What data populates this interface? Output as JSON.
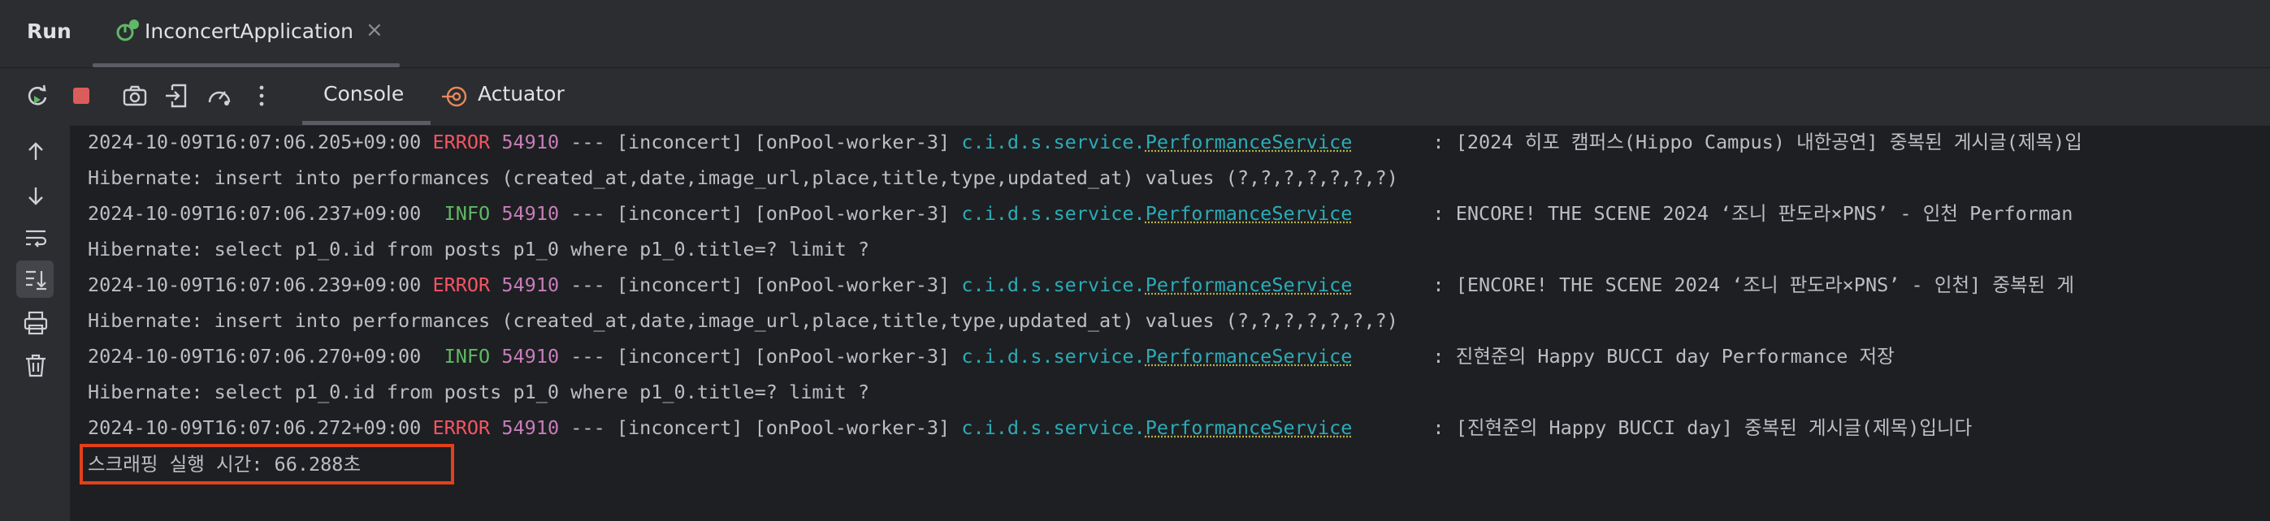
{
  "header": {
    "run_label": "Run",
    "app_tab_label": "InconcertApplication",
    "close_glyph": "×"
  },
  "toolbar": {
    "icons": [
      "rerun-icon",
      "stop-icon",
      "camera-icon",
      "exit-icon",
      "dashboard-icon",
      "more-icon"
    ],
    "console_tab": "Console",
    "actuator_tab": "Actuator"
  },
  "gutter": {
    "icons": [
      "arrow-up-icon",
      "arrow-down-icon",
      "soft-wrap-icon",
      "scroll-to-end-icon",
      "print-icon",
      "trash-icon"
    ]
  },
  "colors": {
    "error": "#f75464",
    "info": "#5fb865",
    "pid": "#c77dba",
    "logger": "#2aacb8",
    "highlight": "#e2401c"
  },
  "console": {
    "lines": [
      {
        "type": "log",
        "timestamp": "2024-10-09T16:07:06.205+09:00",
        "level": "ERROR",
        "pid": "54910",
        "sep": " --- ",
        "app": "[inconcert] [onPool-worker-3] ",
        "logger_pkg": "c.i.d.s.service.",
        "logger_cls": "PerformanceService",
        "msg": "       : [2024 히포 캠퍼스(Hippo Campus) 내한공연] 중복된 게시글(제목)입"
      },
      {
        "type": "text",
        "text": "Hibernate: insert into performances (created_at,date,image_url,place,title,type,updated_at) values (?,?,?,?,?,?,?)"
      },
      {
        "type": "log",
        "timestamp": "2024-10-09T16:07:06.237+09:00",
        "level": " INFO",
        "pid": "54910",
        "sep": " --- ",
        "app": "[inconcert] [onPool-worker-3] ",
        "logger_pkg": "c.i.d.s.service.",
        "logger_cls": "PerformanceService",
        "msg": "       : ENCORE! THE SCENE 2024 ‘조니 판도라×PNS’ - 인천 Performan"
      },
      {
        "type": "text",
        "text": "Hibernate: select p1_0.id from posts p1_0 where p1_0.title=? limit ?"
      },
      {
        "type": "log",
        "timestamp": "2024-10-09T16:07:06.239+09:00",
        "level": "ERROR",
        "pid": "54910",
        "sep": " --- ",
        "app": "[inconcert] [onPool-worker-3] ",
        "logger_pkg": "c.i.d.s.service.",
        "logger_cls": "PerformanceService",
        "msg": "       : [ENCORE! THE SCENE 2024 ‘조니 판도라×PNS’ - 인천] 중복된 게"
      },
      {
        "type": "text",
        "text": "Hibernate: insert into performances (created_at,date,image_url,place,title,type,updated_at) values (?,?,?,?,?,?,?)"
      },
      {
        "type": "log",
        "timestamp": "2024-10-09T16:07:06.270+09:00",
        "level": " INFO",
        "pid": "54910",
        "sep": " --- ",
        "app": "[inconcert] [onPool-worker-3] ",
        "logger_pkg": "c.i.d.s.service.",
        "logger_cls": "PerformanceService",
        "msg": "       : 진현준의 Happy BUCCI day Performance 저장"
      },
      {
        "type": "text",
        "text": "Hibernate: select p1_0.id from posts p1_0 where p1_0.title=? limit ?"
      },
      {
        "type": "log",
        "timestamp": "2024-10-09T16:07:06.272+09:00",
        "level": "ERROR",
        "pid": "54910",
        "sep": " --- ",
        "app": "[inconcert] [onPool-worker-3] ",
        "logger_pkg": "c.i.d.s.service.",
        "logger_cls": "PerformanceService",
        "msg": "       : [진현준의 Happy BUCCI day] 중복된 게시글(제목)입니다"
      },
      {
        "type": "text",
        "text": "스크래핑 실행 시간: 66.288초"
      }
    ]
  }
}
